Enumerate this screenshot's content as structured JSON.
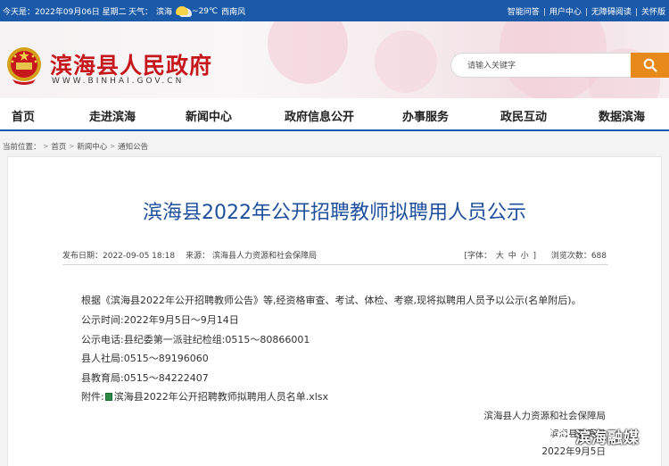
{
  "topbar": {
    "date": "今天是：2022年09月06日 星期二",
    "weather_label": "天气：",
    "weather_city": "滨海",
    "temperature": "~29℃",
    "wind": "西南风",
    "links": [
      "智能问答",
      "用户中心",
      "无障碍阅读",
      "关怀版"
    ]
  },
  "header": {
    "site_title": "滨海县人民政府",
    "site_url": "WWW.BINHAI.GOV.CN",
    "search_placeholder": "请输入关键字"
  },
  "nav": {
    "items": [
      "首页",
      "走进滨海",
      "新闻中心",
      "政府信息公开",
      "办事服务",
      "政民互动",
      "数据滨海"
    ]
  },
  "breadcrumb": {
    "label": "当前位置：",
    "items": [
      "首页",
      "新闻中心",
      "通知公告"
    ]
  },
  "article": {
    "title": "滨海县2022年公开招聘教师拟聘用人员公示",
    "publish_date": "发布日期：2022-09-05 18:18",
    "source": "来源： 滨海县人力资源和社会保障局",
    "font_label": "[字体：",
    "font_sizes": [
      "大",
      "中",
      "小"
    ],
    "font_close": "]",
    "views": "浏览次数：688",
    "paragraphs": [
      "根据《滨海县2022年公开招聘教师公告》等,经资格审查、考试、体检、考察,现将拟聘用人员予以公示(名单附后)。",
      "公示时间:2022年9月5日～9月14日",
      "公示电话:县纪委第一派驻纪检组:0515～80866001",
      "县人社局:0515～89196060",
      "县教育局:0515～84222407"
    ],
    "attachment_label": "附件:",
    "attachment_file": "滨海县2022年公开招聘教师拟聘用人员名单.xlsx",
    "signature_1": "滨海县人力资源和社会保障局",
    "signature_2": "滨海县教育局",
    "signature_date": "2022年9月5日"
  },
  "watermark": {
    "text": "滨海融媒"
  },
  "colors": {
    "primary_blue": "#1a5aa8",
    "title_red": "#c5171c",
    "title_blue": "#1e4f9c",
    "search_orange": "#e88a1b"
  }
}
